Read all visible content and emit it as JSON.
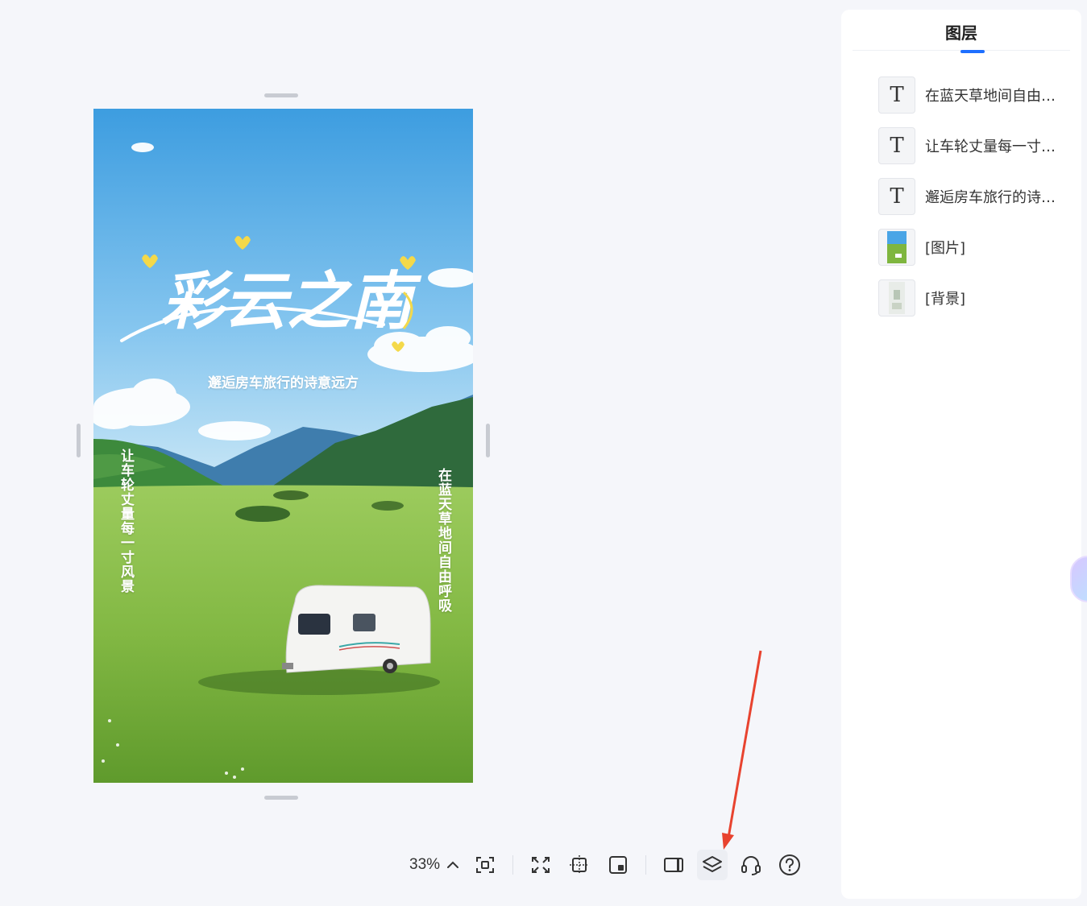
{
  "canvas": {
    "title_art": "彩云之南",
    "subtitle": "邂逅房车旅行的诗意远方",
    "left_vertical": "让车轮丈量每一寸风景",
    "right_vertical": "在蓝天草地间自由呼吸"
  },
  "toolbar": {
    "zoom_value": "33%",
    "buttons": [
      "fit-screen-icon",
      "fullscreen-icon",
      "guides-icon",
      "minimap-icon",
      "panel-toggle-icon",
      "layers-icon",
      "support-headset-icon",
      "help-icon"
    ]
  },
  "panel": {
    "title": "图层",
    "layers": [
      {
        "type": "text",
        "thumb": "T",
        "label": "在蓝天草地间自由…"
      },
      {
        "type": "text",
        "thumb": "T",
        "label": "让车轮丈量每一寸…"
      },
      {
        "type": "text",
        "thumb": "T",
        "label": "邂逅房车旅行的诗…"
      },
      {
        "type": "image",
        "label": "[图片]"
      },
      {
        "type": "background",
        "label": "[背景]"
      }
    ]
  },
  "colors": {
    "accent": "#1e6fff",
    "annotation_arrow": "#e8432f",
    "panel_bg": "#ffffff",
    "workspace_bg": "#f5f6fa"
  }
}
